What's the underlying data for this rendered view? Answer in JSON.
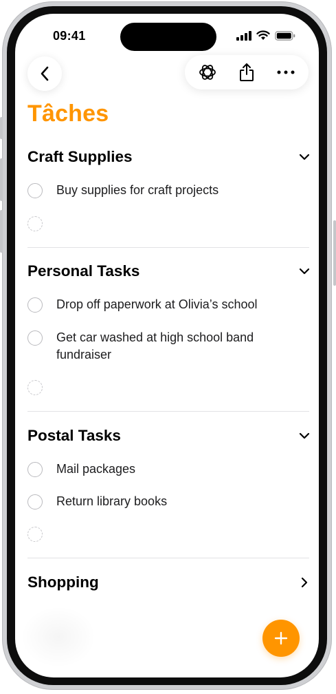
{
  "status": {
    "time": "09:41"
  },
  "nav": {
    "title": "Tâches"
  },
  "colors": {
    "accent": "#ff9500"
  },
  "icons": [
    "back-chevron-icon",
    "apple-intelligence-icon",
    "share-icon",
    "more-icon",
    "chevron-down-icon",
    "chevron-right-icon",
    "plus-icon",
    "signal-icon",
    "wifi-icon",
    "battery-icon"
  ],
  "sections": [
    {
      "title": "Craft Supplies",
      "expanded": true,
      "tasks": [
        "Buy supplies for craft projects"
      ]
    },
    {
      "title": "Personal Tasks",
      "expanded": true,
      "tasks": [
        "Drop off paperwork at Olivia’s school",
        "Get car washed at high school band fundraiser"
      ]
    },
    {
      "title": "Postal Tasks",
      "expanded": true,
      "tasks": [
        "Mail packages",
        "Return library books"
      ]
    },
    {
      "title": "Shopping",
      "expanded": false,
      "tasks": []
    }
  ]
}
